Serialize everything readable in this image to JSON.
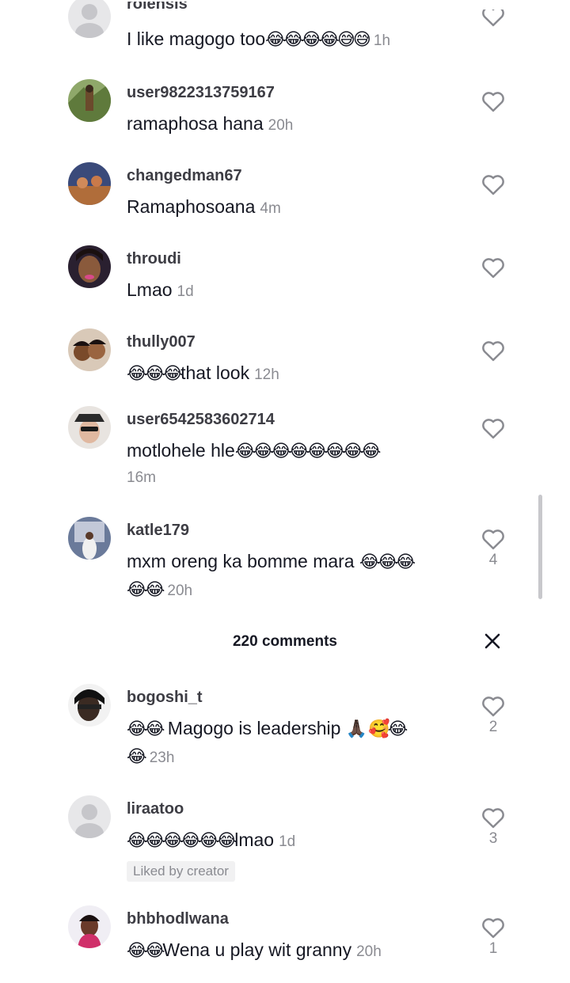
{
  "sheet": {
    "title": "220 comments",
    "close_icon": "close-icon"
  },
  "colors": {
    "text": "#161823",
    "muted": "#8a8b91",
    "username": "#3d3d44"
  },
  "top_comments": [
    {
      "username": "rolensis",
      "text": "I like magogo too",
      "emoji": "😂😂😂😂😅😅",
      "time": "1h",
      "likes": ""
    },
    {
      "username": "user9822313759167",
      "text": "ramaphosa hana",
      "emoji": "",
      "time": "20h",
      "likes": ""
    },
    {
      "username": "changedman67",
      "text": "Ramaphosoana",
      "emoji": "",
      "time": "4m",
      "likes": ""
    },
    {
      "username": "throudi",
      "text": "Lmao",
      "emoji": "",
      "time": "1d",
      "likes": ""
    },
    {
      "username": "thully007",
      "emoji_prefix": "😂😂😂",
      "text": "that look",
      "time": "12h",
      "likes": ""
    },
    {
      "username": "user6542583602714",
      "text": "motlohele hle",
      "emoji": "😂😂😂😂😂😂😂😂",
      "time": "16m",
      "likes": ""
    },
    {
      "username": "katle179",
      "text": "mxm oreng ka bomme mara ",
      "emoji": "😂😂😂",
      "cont_emoji": "😂😂",
      "time": "20h",
      "likes": "4"
    }
  ],
  "bottom_comments": [
    {
      "username": "bogoshi_t",
      "emoji_prefix": "😂😂",
      "text": " Magogo is leadership ",
      "emoji": "🙏🏿 🥰😂",
      "cont_emoji": "😂",
      "time": "23h",
      "likes": "2"
    },
    {
      "username": "liraatoo",
      "emoji_prefix": "😂😂😂😂😂😂",
      "text": "lmao",
      "time": "1d",
      "likes": "3",
      "badge": "Liked by creator"
    },
    {
      "username": "bhbhodlwana",
      "emoji_prefix": "😂😂",
      "text": "Wena u play wit granny",
      "time": "20h",
      "likes": "1"
    }
  ]
}
